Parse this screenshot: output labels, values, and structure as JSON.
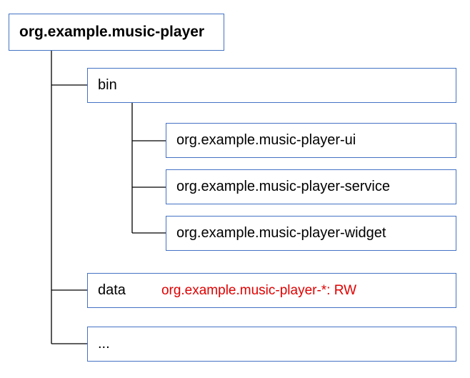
{
  "tree": {
    "root": "org.example.music-player",
    "bin_label": "bin",
    "bin_children": [
      "org.example.music-player-ui",
      "org.example.music-player-service",
      "org.example.music-player-widget"
    ],
    "data_label": "data",
    "data_rule": "org.example.music-player-*:  RW",
    "more_label": "..."
  }
}
